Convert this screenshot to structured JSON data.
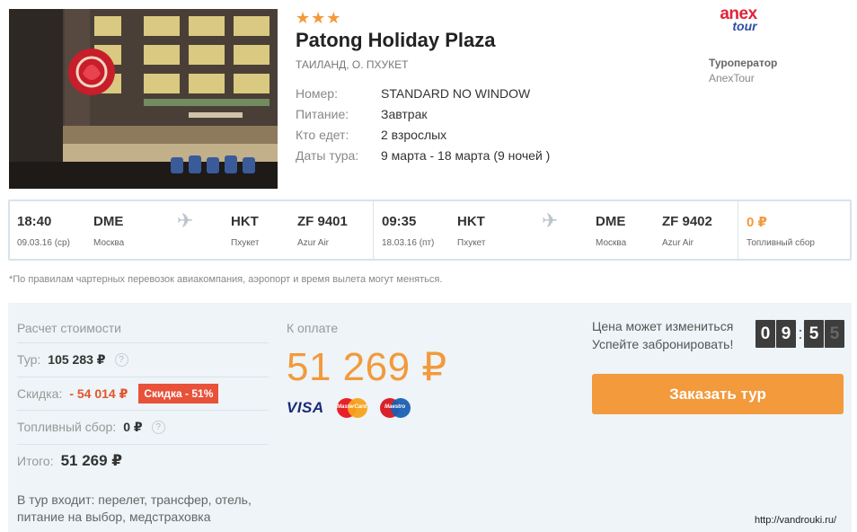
{
  "hotel": {
    "stars": "★★★",
    "name": "Patong Holiday Plaza",
    "location": "ТАИЛАНД, О. ПХУКЕТ",
    "details": [
      {
        "label": "Номер:",
        "value": "STANDARD NO WINDOW"
      },
      {
        "label": "Питание:",
        "value": "Завтрак"
      },
      {
        "label": "Кто едет:",
        "value": "2 взрослых"
      },
      {
        "label": "Даты тура:",
        "value": "9 марта - 18 марта (9 ночей )"
      }
    ]
  },
  "operator": {
    "logo_text_1": "anex",
    "logo_text_2": "tour",
    "label": "Туроператор",
    "name": "AnexTour"
  },
  "flights": {
    "outbound": {
      "time": "18:40",
      "date": "09.03.16 (ср)",
      "from_code": "DME",
      "from_city": "Москва",
      "to_code": "HKT",
      "to_city": "Пхукет",
      "flight_no": "ZF 9401",
      "airline": "Azur Air"
    },
    "return": {
      "time": "09:35",
      "date": "18.03.16 (пт)",
      "from_code": "HKT",
      "from_city": "Пхукет",
      "to_code": "DME",
      "to_city": "Москва",
      "flight_no": "ZF 9402",
      "airline": "Azur Air"
    },
    "fuel": {
      "value": "0 ₽",
      "label": "Топливный сбор"
    }
  },
  "disclaimer": "*По правилам чартерных перевозок авиакомпания, аэропорт и время вылета могут меняться.",
  "cost": {
    "title": "Расчет стоимости",
    "tour_label": "Тур:",
    "tour_value": "105 283 ₽",
    "discount_label": "Скидка:",
    "discount_value": "- 54 014 ₽",
    "discount_badge": "Скидка - 51%",
    "fuel_label": "Топливный сбор:",
    "fuel_value": "0 ₽",
    "total_label": "Итого:",
    "total_value": "51 269 ₽",
    "includes": "В тур входит: перелет, трансфер, отель, питание на выбор, медстраховка"
  },
  "payment": {
    "title": "К оплате",
    "amount": "51 269 ₽",
    "cards": {
      "visa": "VISA",
      "mastercard": "MasterCard",
      "maestro": "Maestro"
    }
  },
  "booking": {
    "line1": "Цена может измениться",
    "line2": "Успейте забронировать!",
    "timer_digits": [
      "0",
      "9",
      "5",
      "5"
    ],
    "button_label": "Заказать тур"
  },
  "watermark": "http://vandrouki.ru/",
  "colors": {
    "accent": "#f29a3c",
    "discount": "#e8523a",
    "panel": "#eef4f7",
    "border": "#d8e3ea"
  }
}
